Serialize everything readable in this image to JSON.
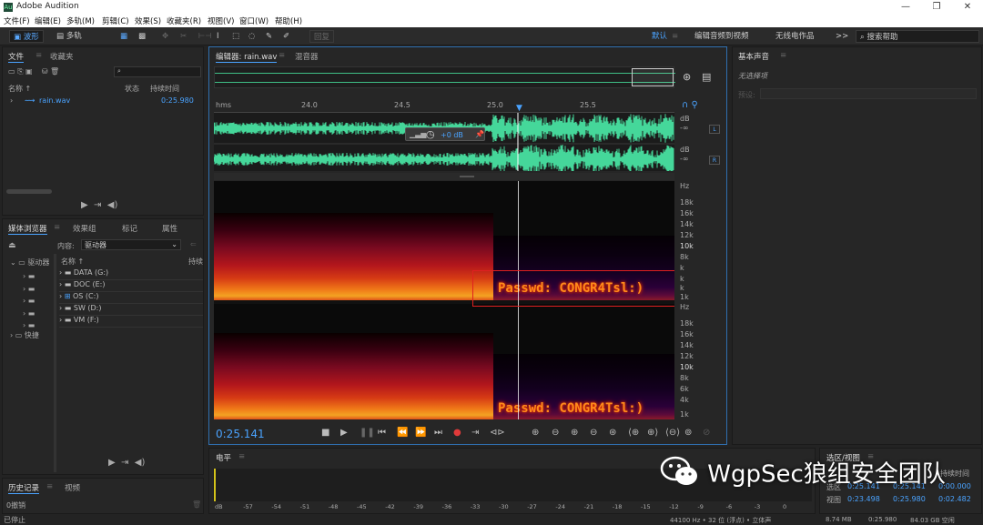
{
  "app": {
    "title": "Adobe Audition",
    "icon": "Au"
  },
  "window_controls": [
    "minimize-icon",
    "maximize-icon",
    "close-icon"
  ],
  "menu": [
    "文件(F)",
    "编辑(E)",
    "多轨(M)",
    "剪辑(C)",
    "效果(S)",
    "收藏夹(R)",
    "视图(V)",
    "窗口(W)",
    "帮助(H)"
  ],
  "toolbar": {
    "waveform": "波形",
    "multitrack": "多轨",
    "restore": "回复",
    "workspace": "默认",
    "ws2": "编辑音频到视频",
    "ws3": "无线电作品",
    "more": ">>",
    "search_placeholder": "搜索帮助"
  },
  "files_panel": {
    "tabs": [
      "文件",
      "收藏夹"
    ],
    "col_name": "名称 ↑",
    "col_status": "状态",
    "col_duration": "持续时间",
    "file_name": "rain.wav",
    "file_duration": "0:25.980"
  },
  "media_panel": {
    "tabs": [
      "媒体浏览器",
      "效果组",
      "标记",
      "属性"
    ],
    "content_label": "内容:",
    "content_value": "驱动器",
    "col_name": "名称 ↑",
    "col_duration": "持续",
    "left_tree": [
      "驱动器",
      "快捷"
    ],
    "drives": [
      "DATA (G:)",
      "DOC (E:)",
      "OS (C:)",
      "SW (D:)",
      "VM (F:)"
    ]
  },
  "history_panel": {
    "tabs": [
      "历史记录",
      "视频"
    ],
    "item": "0撤销",
    "status": "已停止"
  },
  "editor": {
    "tab_editor": "编辑器: rain.wav",
    "tab_mixer": "混音器",
    "ruler": [
      "hms",
      "24.0",
      "24.5",
      "25.0",
      "25.5"
    ],
    "db_label": "dB",
    "channel_left": "L",
    "channel_right": "R",
    "gain": "+0 dB",
    "hz_unit": "Hz",
    "hz_ticks": [
      "18k",
      "16k",
      "14k",
      "12k",
      "10k",
      "8k",
      "6k",
      "4k",
      "2k",
      "1k"
    ],
    "hz_ticks_partial": [
      "k",
      "k",
      "k",
      "1k"
    ],
    "hidden_text": "Passwd: CONGR4Tsl:)",
    "time": "0:25.141"
  },
  "essential_sound": {
    "title": "基本声音",
    "subtitle": "无选择项",
    "preset": "预设:"
  },
  "level_panel": {
    "title": "电平",
    "scale": [
      "dB",
      "-57",
      "-54",
      "-51",
      "-48",
      "-45",
      "-42",
      "-39",
      "-36",
      "-33",
      "-30",
      "-27",
      "-24",
      "-21",
      "-18",
      "-15",
      "-12",
      "-9",
      "-6",
      "-3",
      "0"
    ]
  },
  "selection_panel": {
    "title": "选区/视图",
    "col_duration": "持续时间",
    "row_selection": "选区",
    "row_view": "视图",
    "sel_start": "0:25.141",
    "sel_end": "0:25.141",
    "sel_dur": "0:00.000",
    "view_start": "0:23.498",
    "view_end": "0:25.980",
    "view_dur": "0:02.482"
  },
  "statusbar": {
    "rate": "44100 Hz • 32 位 (浮点) • 立体声",
    "size": "8.74 MB",
    "dur": "0:25.980",
    "space": "84.03 GB 空闲"
  },
  "watermark": "WgpSec狼组安全团队",
  "colors": {
    "waveform": "#45d79a",
    "accent": "#4aa3ff",
    "playhead": "#ffffff",
    "record": "#e03a3a",
    "highlight_box": "#e02020"
  }
}
